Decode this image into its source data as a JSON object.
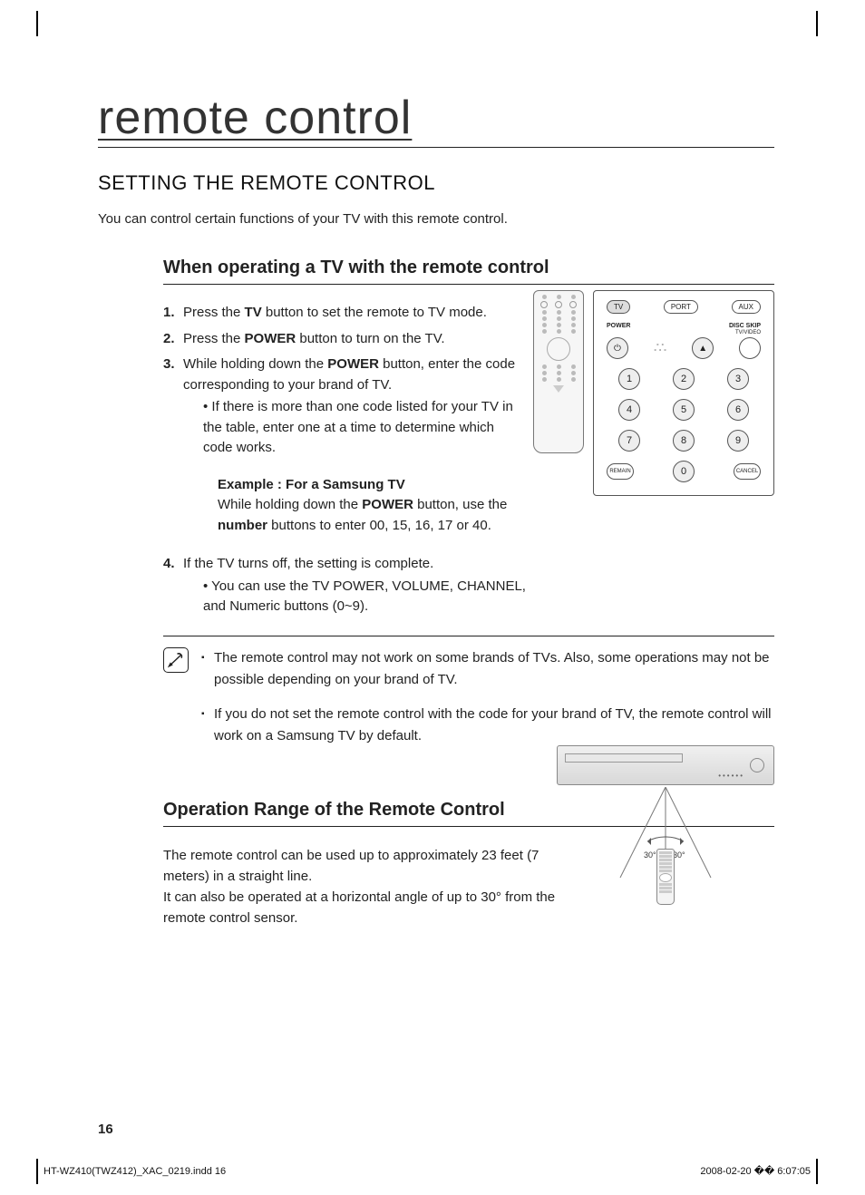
{
  "title": "remote control",
  "h2": "SETTING THE REMOTE CONTROL",
  "intro": "You can control certain functions of your TV with this remote control.",
  "tv_heading": "When operating a TV with the remote control",
  "steps": {
    "s1_pre": "Press the ",
    "s1_b": "TV",
    "s1_post": " button to set the remote to TV mode.",
    "s2_pre": "Press the ",
    "s2_b": "POWER",
    "s2_post": " button to turn on the TV.",
    "s3_pre": "While holding down the ",
    "s3_b": "POWER",
    "s3_post": " button, enter the code corresponding to your brand of TV.",
    "s3_sub": "If there is more than one code listed for your TV in the table, enter one at a time to determine which code works.",
    "example_title": "Example : For a Samsung TV",
    "example_pre": "While holding down the ",
    "example_b1": "POWER",
    "example_mid": " button, use the ",
    "example_b2": "number",
    "example_post": " buttons to enter 00, 15, 16, 17 or 40.",
    "s4": "If the TV turns off, the setting is complete.",
    "s4_sub": "You can use the TV POWER, VOLUME, CHANNEL, and Numeric buttons (0~9)."
  },
  "notes": {
    "n1": "The remote control may not work on some brands of TVs. Also, some operations may not be possible depending on your brand of TV.",
    "n2": "If you do not set the remote control with the code for your brand of TV, the remote control will work on a Samsung TV by default."
  },
  "op_heading": "Operation Range of the Remote Control",
  "op_body1": "The remote control can be used up to approximately 23 feet (7 meters) in a straight line.",
  "op_body2": "It can also be operated at a horizontal angle of up to 30° from the remote control sensor.",
  "remote": {
    "modes": {
      "tv": "TV",
      "port": "PORT",
      "aux": "AUX"
    },
    "power_label": "POWER",
    "eject_label_top": "DISC SKIP",
    "eject_label_sub": "TV/VIDEO",
    "nums": [
      "1",
      "2",
      "3",
      "4",
      "5",
      "6",
      "7",
      "8",
      "9",
      "0"
    ],
    "remain": "REMAIN",
    "cancel": "CANCEL",
    "eject": "▲",
    "power": "⏻"
  },
  "range_angle": "30°",
  "page_number": "16",
  "footer_left": "HT-WZ410(TWZ412)_XAC_0219.indd   16",
  "footer_right": "2008-02-20   �� 6:07:05"
}
